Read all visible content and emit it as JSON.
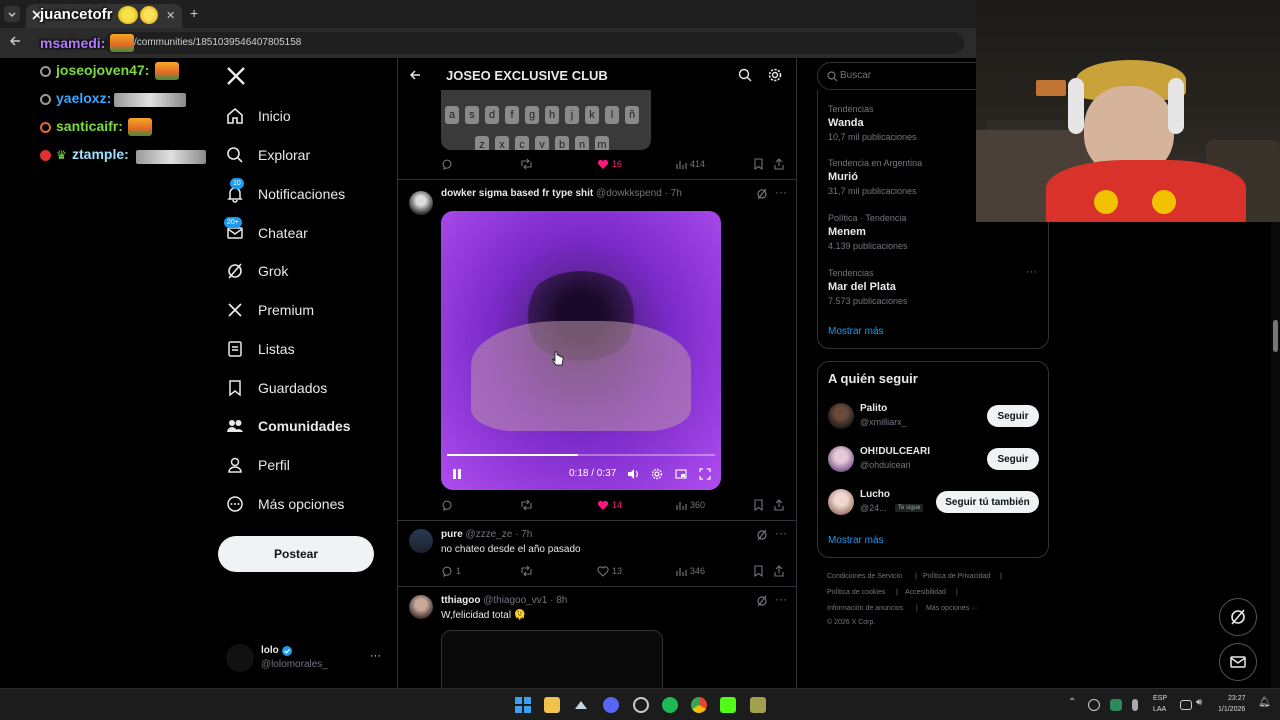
{
  "browser": {
    "tab_title": "juancetofr",
    "url": "/communities/1851039546407805158",
    "new_tab_icon": "plus-icon"
  },
  "chat": {
    "lines": [
      {
        "user": "msamedi",
        "color": "#b57cff"
      },
      {
        "user": "joseojoven47",
        "color": "#7bdc3b"
      },
      {
        "user": "yaeloxz",
        "color": "#3ba7ff"
      },
      {
        "user": "santicaifr",
        "color": "#7bdc3b"
      },
      {
        "user": "ztample",
        "color": "#9fe0ff"
      }
    ],
    "separator": ":"
  },
  "nav": {
    "items": [
      {
        "label": "Inicio",
        "icon": "home-icon"
      },
      {
        "label": "Explorar",
        "icon": "search-icon"
      },
      {
        "label": "Notificaciones",
        "icon": "bell-icon",
        "badge": "10"
      },
      {
        "label": "Chatear",
        "icon": "mail-icon",
        "badge": "20+"
      },
      {
        "label": "Grok",
        "icon": "grok-icon"
      },
      {
        "label": "Premium",
        "icon": "x-logo-icon"
      },
      {
        "label": "Listas",
        "icon": "list-icon"
      },
      {
        "label": "Guardados",
        "icon": "bookmark-icon"
      },
      {
        "label": "Comunidades",
        "icon": "people-icon"
      },
      {
        "label": "Perfil",
        "icon": "person-icon"
      },
      {
        "label": "Más opciones",
        "icon": "more-circle-icon"
      }
    ],
    "post_label": "Postear",
    "account": {
      "name": "lolo",
      "handle": "@lolomorales_",
      "more": "···"
    }
  },
  "community": {
    "title": "JOSEO EXCLUSIVE CLUB"
  },
  "keyboard": {
    "row1": [
      "a",
      "s",
      "d",
      "f",
      "g",
      "h",
      "j",
      "k",
      "l",
      "ñ"
    ],
    "row2": [
      "z",
      "x",
      "c",
      "v",
      "b",
      "n",
      "m"
    ]
  },
  "posts": [
    {
      "stats": {
        "replies": "",
        "reposts": "",
        "likes": "16",
        "views": "414"
      }
    },
    {
      "author": "dowker sigma based fr type shit",
      "handle": "@dowkkspend",
      "time": "· 7h",
      "video": {
        "time": "0:18 / 0:37",
        "progress": 0.49
      },
      "stats": {
        "replies": "",
        "reposts": "",
        "likes": "14",
        "views": "360"
      }
    },
    {
      "author": "pure",
      "handle": "@zzze_ze",
      "time": "· 7h",
      "text": "no chateo desde el año pasado",
      "stats": {
        "replies": "1",
        "reposts": "",
        "likes": "13",
        "views": "346"
      }
    },
    {
      "author": "tthiagoo",
      "handle": "@thiagoo_vv1",
      "time": "· 8h",
      "text": "W,felicidad total 🫠"
    }
  ],
  "sidebar": {
    "search_placeholder": "Buscar",
    "trends": [
      {
        "category": "Tendencias",
        "name": "Wanda",
        "count": "10,7 mil publicaciones"
      },
      {
        "category": "Tendencia en Argentina",
        "name": "Murió",
        "count": "31,7 mil publicaciones"
      },
      {
        "category": "Política · Tendencia",
        "name": "Menem",
        "count": "4.139 publicaciones"
      },
      {
        "category": "Tendencias",
        "name": "Mar del Plata",
        "count": "7.573 publicaciones"
      }
    ],
    "trends_more": "Mostrar más",
    "who_to_follow_title": "A quién seguir",
    "follow": [
      {
        "name": "Palito",
        "handle": "@xmilliarx_",
        "button": "Seguir"
      },
      {
        "name": "OH!DULCEARI",
        "handle": "@ohdulceari",
        "button": "Seguir"
      },
      {
        "name": "Lucho",
        "handle": "@24...",
        "badge": "Te sigue",
        "button": "Seguir tú también"
      }
    ],
    "follow_more": "Mostrar más",
    "footer": [
      "Condiciones de Servicio",
      "|",
      "Política de Privacidad",
      "|",
      "Política de cookies",
      "|",
      "Accesibilidad",
      "|",
      "Información de anuncios",
      "|",
      "Más opciones ···",
      "© 2026 X Corp."
    ]
  },
  "taskbar": {
    "lang": "ESP",
    "lang2": "LAA",
    "time": "23:27",
    "date": "1/1/2026"
  },
  "colors": {
    "accent": "#1d9bf0",
    "like": "#f91880",
    "bg": "#000000",
    "border": "#2f3336"
  }
}
